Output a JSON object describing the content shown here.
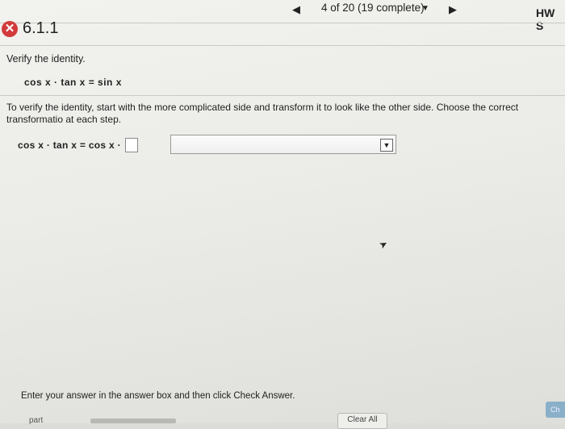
{
  "nav": {
    "prev_icon": "triangle-left-icon",
    "progress": "4 of 20 (19 complete)",
    "progress_caret_icon": "caret-down-icon",
    "next_icon": "triangle-right-icon",
    "hw_label": "HW S"
  },
  "question": {
    "status_icon": "incorrect-x-icon",
    "status_color": "#d23b3b",
    "number": "6.1.1",
    "prompt": "Verify the identity.",
    "identity": "cos x · tan x = sin x",
    "instructions": "To verify the identity, start with the more complicated side and transform it to look like the other side. Choose the correct transformatio at each step.",
    "step_expression": "cos x · tan x = cos x ·",
    "answer_value": "",
    "dropdown_selected": ""
  },
  "footer": {
    "hint": "Enter your answer in the answer box and then click Check Answer.",
    "clear_all": "Clear All",
    "check_answer": "Ch",
    "part_label": "part"
  }
}
